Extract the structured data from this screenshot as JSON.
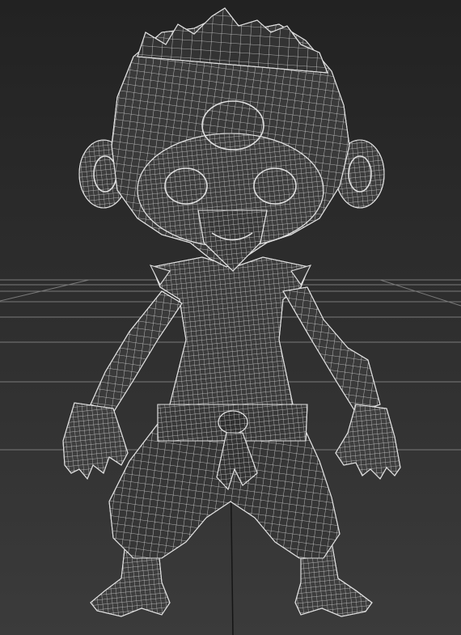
{
  "viewport": {
    "background_top": "#222222",
    "background_bottom": "#3b3b3b",
    "grid_color": "#7a7a7a",
    "grid_axis_color": "#151515",
    "mesh_fill": "#3d3d3d",
    "mesh_shade": "#2d2d2d",
    "wire_color": "#d6d6d6",
    "display_mode": "wireframe",
    "subject_icon": "chibi-monkey-character-mesh-icon"
  }
}
